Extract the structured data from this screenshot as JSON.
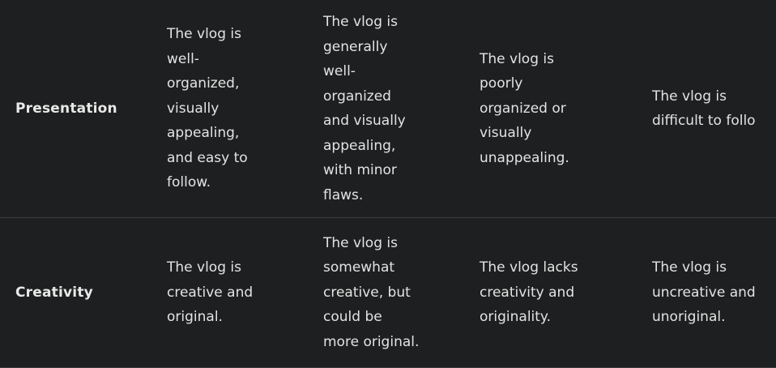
{
  "rows": [
    {
      "criterion": "Presentation",
      "cells": [
        "The vlog is\nwell-\norganized,\nvisually\nappealing,\nand easy to\nfollow.",
        "The vlog is\ngenerally\nwell-\norganized\nand visually\nappealing,\nwith minor\nflaws.",
        "The vlog is\npoorly\norganized or\nvisually\nunappealing.",
        "The vlog is\ndifficult to follo"
      ]
    },
    {
      "criterion": "Creativity",
      "cells": [
        "The vlog is\ncreative and\noriginal.",
        "The vlog is\nsomewhat\ncreative, but\ncould be\nmore original.",
        "The vlog lacks\ncreativity and\noriginality.",
        "The vlog is\nuncreative and\nunoriginal."
      ]
    }
  ]
}
